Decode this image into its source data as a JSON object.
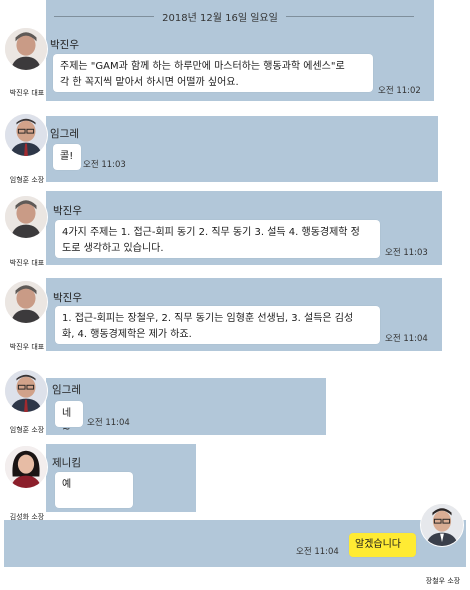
{
  "date_divider": "2018년 12월 16일 일요일",
  "messages": [
    {
      "sender": "박진우",
      "avatar_icon": "man-gray-hair-avatar",
      "caption": "박진우 대표",
      "lines": [
        "주제는 \"GAM과 함께 하는 하루만에 마스터하는 행동과학 에센스\"로",
        "각 한 꼭지씩 맡아서 하시면 어떨까 싶어요."
      ],
      "time": "오전 11:02"
    },
    {
      "sender": "임그레",
      "avatar_icon": "man-glasses-avatar",
      "caption": "임형훈 소장",
      "lines": [
        "콜!"
      ],
      "time": "오전 11:03"
    },
    {
      "sender": "박진우",
      "avatar_icon": "man-gray-hair-avatar",
      "caption": "박진우 대표",
      "lines": [
        "4가지 주제는 1. 접근-회피 동기 2. 직무 동기 3. 설득 4. 행동경제학 정",
        "도로 생각하고 있습니다."
      ],
      "time": "오전 11:03"
    },
    {
      "sender": "박진우",
      "avatar_icon": "man-gray-hair-avatar",
      "caption": "박진우 대표",
      "lines": [
        "1. 접근-회피는 장철우, 2. 직무 동기는 임형훈 선생님, 3. 설득은 김성",
        "화, 4. 행동경제학은 제가 하죠."
      ],
      "time": "오전 11:04"
    },
    {
      "sender": "임그레",
      "avatar_icon": "man-glasses-avatar",
      "caption": "임형훈 소장",
      "lines": [
        "네~"
      ],
      "time": "오전 11:04"
    },
    {
      "sender": "제니킴",
      "avatar_icon": "woman-avatar",
      "caption": "김성화 소장",
      "lines": [
        "예"
      ],
      "time": ""
    }
  ],
  "my_message": {
    "text": "알겠습니다",
    "time": "오전 11:04",
    "caption": "장철우 소장",
    "avatar_icon": "man-glasses-suit-avatar"
  },
  "colors": {
    "chat_background": "#b2c7d9",
    "my_bubble": "#ffeb33",
    "other_bubble": "#ffffff"
  }
}
